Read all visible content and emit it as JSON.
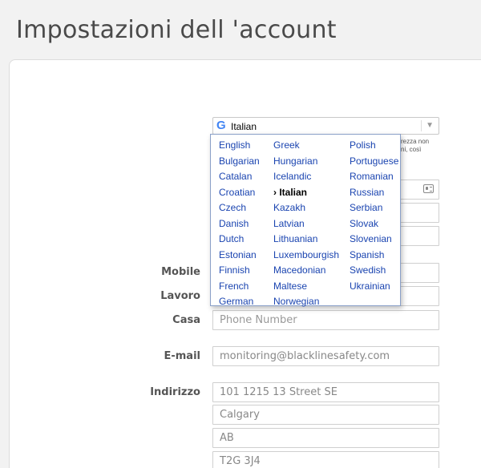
{
  "page": {
    "title": "Impostazioni dell 'account"
  },
  "translate": {
    "selected_language": "Italian",
    "partial_note_line1": "rezza non",
    "partial_note_line2": "ni, così"
  },
  "languages": {
    "col1": [
      "English",
      "Bulgarian",
      "Catalan",
      "Croatian",
      "Czech",
      "Danish",
      "Dutch",
      "Estonian",
      "Finnish",
      "French",
      "German"
    ],
    "col2": [
      "Greek",
      "Hungarian",
      "Icelandic",
      "› Italian",
      "Kazakh",
      "Latvian",
      "Lithuanian",
      "Luxembourgish",
      "Macedonian",
      "Maltese",
      "Norwegian"
    ],
    "col3": [
      "Polish",
      "Portuguese",
      "Romanian",
      "Russian",
      "Serbian",
      "Slovak",
      "Slovenian",
      "Spanish",
      "Swedish",
      "Ukrainian"
    ]
  },
  "form": {
    "mobile_label": "Mobile",
    "work_label": "Lavoro",
    "home_label": "Casa",
    "home_placeholder": "Phone Number",
    "email_label": "E-mail",
    "email_value": "monitoring@blacklinesafety.com",
    "address_label": "Indirizzo",
    "address_line1": "101 1215 13 Street SE",
    "city": "Calgary",
    "province": "AB",
    "postal_code": "T2G 3J4"
  }
}
